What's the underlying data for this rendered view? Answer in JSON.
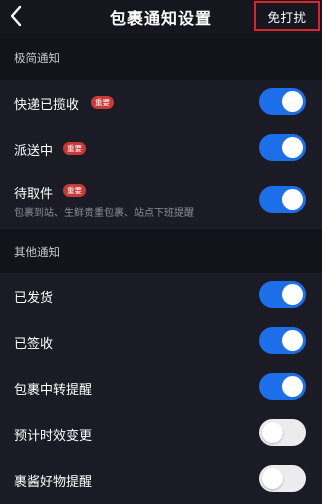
{
  "header": {
    "title": "包裹通知设置",
    "dnd_label": "免打扰"
  },
  "colors": {
    "toggle_on": "#1c6fe8",
    "toggle_off": "#ececee",
    "badge": "#c73a37",
    "highlight_border": "#d8252e"
  },
  "sections": [
    {
      "title": "极简通知",
      "items": [
        {
          "label": "快递已揽收",
          "badge": "重要",
          "subtitle": "",
          "enabled": true
        },
        {
          "label": "派送中",
          "badge": "重要",
          "subtitle": "",
          "enabled": true
        },
        {
          "label": "待取件",
          "badge": "重要",
          "subtitle": "包裹到站、生鲜贵重包裹、站点下班提醒",
          "enabled": true
        }
      ]
    },
    {
      "title": "其他通知",
      "items": [
        {
          "label": "已发货",
          "enabled": true
        },
        {
          "label": "已签收",
          "enabled": true
        },
        {
          "label": "包裹中转提醒",
          "enabled": true
        },
        {
          "label": "预计时效变更",
          "enabled": false
        },
        {
          "label": "裹酱好物提醒",
          "enabled": false
        }
      ]
    }
  ]
}
